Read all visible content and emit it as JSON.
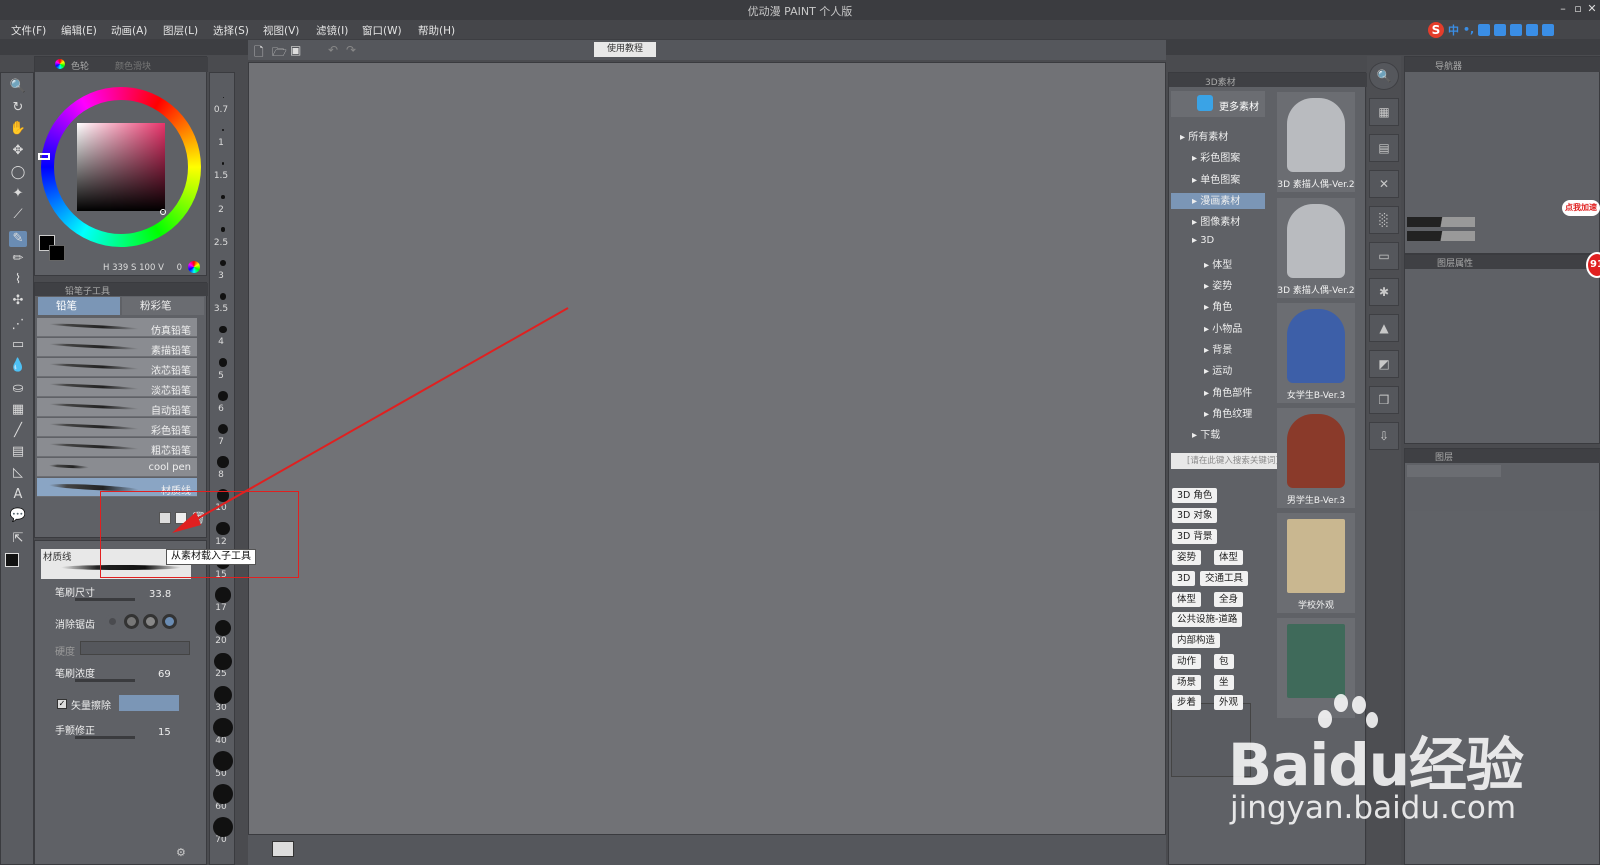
{
  "window": {
    "title": "优动漫 PAINT 个人版"
  },
  "menu": [
    "文件(F)",
    "编辑(E)",
    "动画(A)",
    "图层(L)",
    "选择(S)",
    "视图(V)",
    "滤镜(I)",
    "窗口(W)",
    "帮助(H)"
  ],
  "toolbar": {
    "tutorial_button": "使用教程"
  },
  "color_panel": {
    "tab_wheel": "色轮",
    "tab_other": "颜色滑块",
    "h": "H 339",
    "s": "S 100",
    "v": "V",
    "v_value": "0"
  },
  "subtool_panel": {
    "title": "铅笔子工具",
    "tabs": [
      "铅笔",
      "粉彩笔"
    ],
    "brushes": [
      "仿真铅笔",
      "素描铅笔",
      "浓芯铅笔",
      "淡芯铅笔",
      "自动铅笔",
      "彩色铅笔",
      "粗芯铅笔",
      "cool pen",
      "材质线"
    ],
    "selected_brush": "材质线",
    "tooltip": "从素材载入子工具"
  },
  "tool_property": {
    "name": "材质线",
    "brush_size_label": "笔刷尺寸",
    "brush_size_value": "33.8",
    "antialias_label": "消除锯齿",
    "hardness_label": "硬度",
    "density_label": "笔刷浓度",
    "density_value": "69",
    "vector_erase_label": "矢量擦除",
    "stabilizer_label": "手颤修正",
    "stabilizer_value": "15"
  },
  "ruler_labels": [
    "0.7",
    "1",
    "1.5",
    "2",
    "2.5",
    "3",
    "3.5",
    "4",
    "5",
    "6",
    "7",
    "8",
    "10",
    "12",
    "15",
    "17",
    "20",
    "25",
    "30",
    "40",
    "50",
    "60",
    "70"
  ],
  "material_panel": {
    "title": "3D素材",
    "more_button": "更多素材",
    "tree": [
      "所有素材",
      "彩色图案",
      "单色图案",
      "漫画素材",
      "图像素材",
      "3D",
      "体型",
      "姿势",
      "角色",
      "小物品",
      "背景",
      "运动",
      "角色部件",
      "角色纹理",
      "下载"
    ],
    "search_placeholder": "[请在此键入搜索关键词]",
    "tags": [
      "3D 角色",
      "3D 对象",
      "3D 背景",
      "姿势",
      "体型",
      "3D",
      "交通工具",
      "体型",
      "全身",
      "公共设施-道路",
      "内部构造",
      "动作",
      "包",
      "场景",
      "坐",
      "步着",
      "外观"
    ],
    "thumbnails": [
      "3D 素描人偶-Ver.2",
      "3D 素描人偶-Ver.2",
      "女学生B-Ver.3",
      "男学生B-Ver.3",
      "学校外观",
      ""
    ]
  },
  "right_panels": {
    "navigator_tab": "导航器",
    "layer_prop_tab": "图层属性",
    "layer_tab": "图层"
  },
  "watermark": {
    "brand": "Baidu经验",
    "url": "jingyan.baidu.com"
  },
  "badge": {
    "accelerate": "点我加速",
    "count": "91"
  },
  "colors": {
    "accent": "#6a8cb3",
    "arrow": "#e02020",
    "highlight_box": "#e02020"
  }
}
